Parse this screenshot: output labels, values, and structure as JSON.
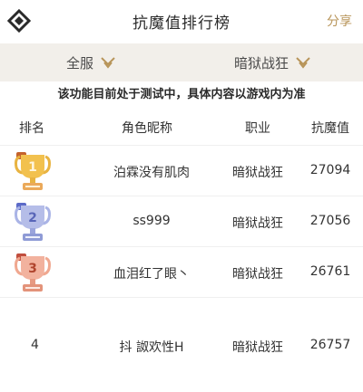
{
  "header": {
    "title": "抗魔值排行榜",
    "share_label": "分享"
  },
  "filters": {
    "server_label": "全服",
    "class_label": "暗狱战狂"
  },
  "notice": "该功能目前处于测试中，具体内容以游戏内为准",
  "columns": {
    "rank": "排名",
    "name": "角色昵称",
    "job": "职业",
    "score": "抗魔值"
  },
  "colors": {
    "accent": "#b8955a",
    "gold": "#e8b341",
    "silver": "#8f9bd6",
    "bronze": "#e3937a",
    "filter_bg": "#f2efea"
  },
  "rows": [
    {
      "rank": "1",
      "name": "泊霖没有肌肉",
      "job": "暗狱战狂",
      "score": "27094",
      "badge": "gold-trophy-icon"
    },
    {
      "rank": "2",
      "name": "ss999",
      "job": "暗狱战狂",
      "score": "27056",
      "badge": "silver-trophy-icon"
    },
    {
      "rank": "3",
      "name": "血泪红了眼丶",
      "job": "暗狱战狂",
      "score": "26761",
      "badge": "bronze-trophy-icon"
    },
    {
      "rank": "4",
      "name": "抖 詉欢性H",
      "job": "暗狱战狂",
      "score": "26757"
    }
  ]
}
